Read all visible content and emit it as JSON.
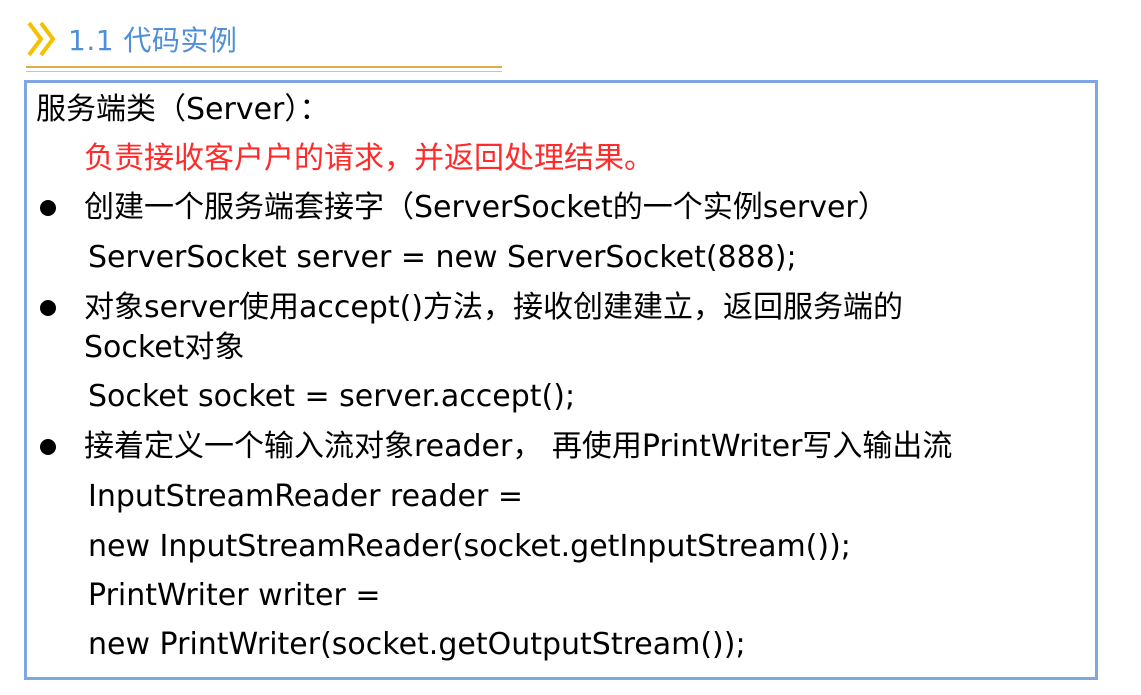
{
  "header": {
    "title": "1.1 代码实例",
    "icon": "double-chevron-right-icon",
    "accent_color": "#f5c000",
    "title_color": "#4f8fd9",
    "rule_color": "#e2ac4a"
  },
  "content": {
    "border_color": "#7ea6e0",
    "class_heading": "服务端类（Server）：",
    "class_desc": "负责接收客户户的请求，并返回处理结果。",
    "items": [
      {
        "bullet_icon": "bullet-dot-icon",
        "text": "创建一个服务端套接字（ServerSocket的一个实例server）",
        "code": [
          "ServerSocket server = new ServerSocket(888);"
        ]
      },
      {
        "bullet_icon": "bullet-dot-icon",
        "text": "对象server使用accept()方法，接收创建建立，返回服务端的",
        "text_cont": "Socket对象",
        "code": [
          "Socket socket = server.accept();"
        ]
      },
      {
        "bullet_icon": "bullet-dot-icon",
        "text": "接着定义一个输入流对象reader，  再使用PrintWriter写入输出流",
        "code": [
          "InputStreamReader reader =",
          "new InputStreamReader(socket.getInputStream());",
          "PrintWriter writer =",
          "new PrintWriter(socket.getOutputStream());"
        ]
      }
    ]
  }
}
